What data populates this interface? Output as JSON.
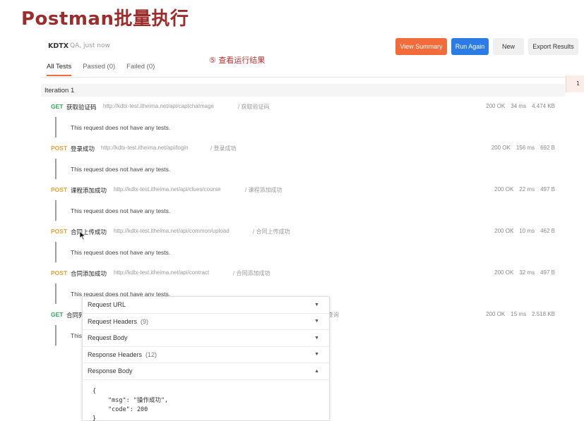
{
  "slide": {
    "title": "Postman批量执行"
  },
  "run": {
    "name": "KDTX",
    "meta": "QA, just now"
  },
  "annotation": "⑤ 查看运行结果",
  "toolbar": {
    "view_summary": "View Summary",
    "run_again": "Run Again",
    "new": "New",
    "export": "Export Results"
  },
  "tabs": [
    {
      "label": "All Tests",
      "active": true
    },
    {
      "label": "Passed (0)",
      "active": false
    },
    {
      "label": "Failed (0)",
      "active": false
    }
  ],
  "iteration": {
    "label": "Iteration 1"
  },
  "right_panel": {
    "label": "1"
  },
  "requests": [
    {
      "method": "GET",
      "name": "获取验证码",
      "url": "http://kdtx-test.itheima.net/api/captchaImage",
      "folder": "/ 获取验证码",
      "status": "200 OK",
      "time": "34 ms",
      "size": "4.474 KB",
      "note": "This request does not have any tests."
    },
    {
      "method": "POST",
      "name": "登录成功",
      "url": "http://kdtx-test.itheima.net/api/login",
      "folder": "/ 登录成功",
      "status": "200 OK",
      "time": "156 ms",
      "size": "692 B",
      "note": "This request does not have any tests."
    },
    {
      "method": "POST",
      "name": "课程添加成功",
      "url": "http://kdtx-test.itheima.net/api/clues/course",
      "folder": "/ 课程添加成功",
      "status": "200 OK",
      "time": "22 ms",
      "size": "497 B",
      "note": "This request does not have any tests."
    },
    {
      "method": "POST",
      "name": "合同上传成功",
      "url": "http://kdtx-test.itheima.net/api/common/upload",
      "folder": "/ 合同上传成功",
      "status": "200 OK",
      "time": "10 ms",
      "size": "462 B",
      "note": "This request does not have any tests."
    },
    {
      "method": "POST",
      "name": "合同添加成功",
      "url": "http://kdtx-test.itheima.net/api/contract",
      "folder": "/ 合同添加成功",
      "status": "200 OK",
      "time": "32 ms",
      "size": "497 B",
      "note": "This request does not have any tests."
    },
    {
      "method": "GET",
      "name": "合同列",
      "url": "",
      "folder": "查询",
      "status": "200 OK",
      "time": "15 ms",
      "size": "2.518 KB",
      "note": "This"
    }
  ],
  "details": {
    "request_url": "Request URL",
    "request_headers": "Request Headers",
    "request_headers_count": "(9)",
    "request_body": "Request Body",
    "response_headers": "Response Headers",
    "response_headers_count": "(12)",
    "response_body": "Response Body",
    "body_lines": [
      "{",
      "\"msg\": \"操作成功\",",
      "\"code\": 200",
      "}"
    ]
  },
  "colors": {
    "accent": "#f26b3a",
    "primary": "#2d7be5",
    "get": "#2eaa57",
    "post": "#e6a13a",
    "title": "#9b2d2d"
  }
}
